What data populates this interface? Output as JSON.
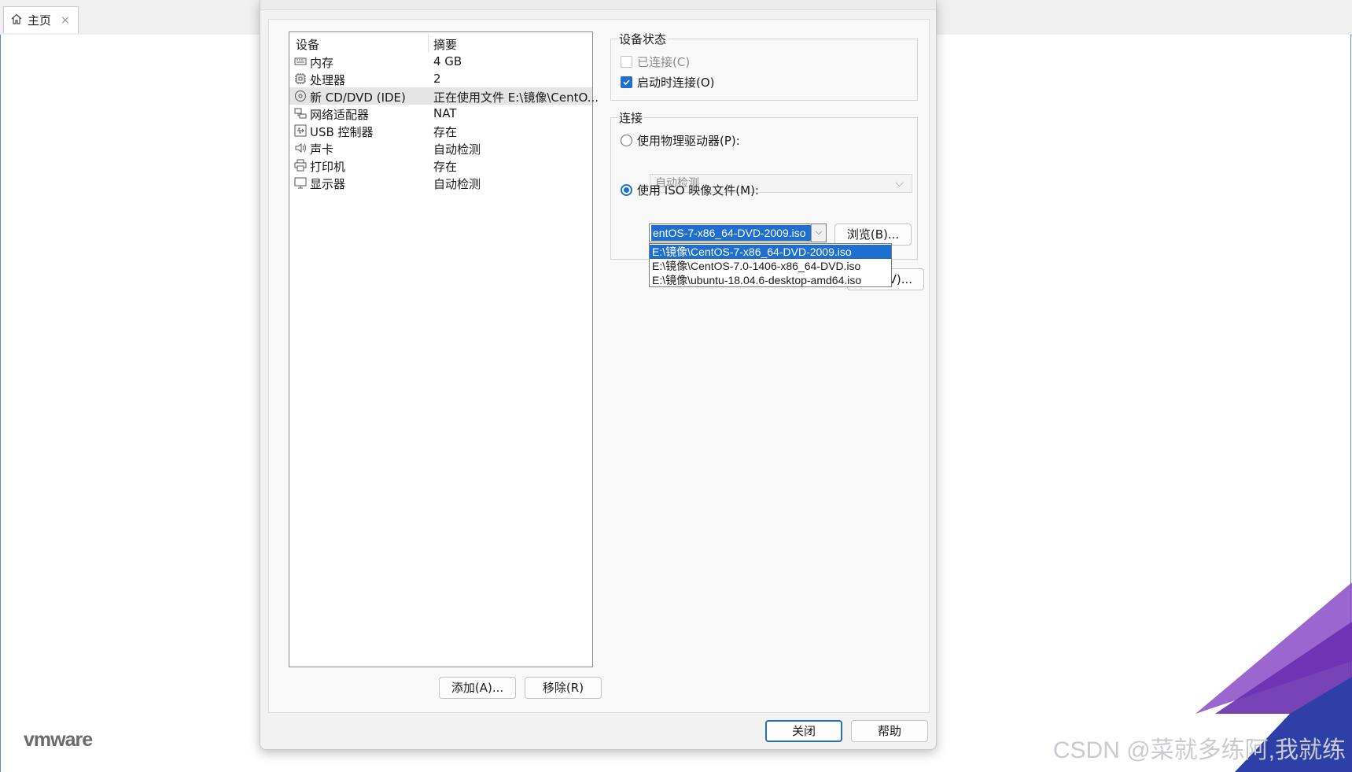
{
  "tab": {
    "label": "主页",
    "close": "×"
  },
  "branding": {
    "logo": "vmware",
    "watermark": "CSDN @菜就多练阿,我就练"
  },
  "device_list": {
    "header": {
      "device": "设备",
      "summary": "摘要"
    },
    "rows": [
      {
        "name": "内存",
        "summary": "4 GB",
        "icon": "memory-icon"
      },
      {
        "name": "处理器",
        "summary": "2",
        "icon": "cpu-icon"
      },
      {
        "name": "新 CD/DVD (IDE)",
        "summary": "正在使用文件 E:\\镜像\\CentO...",
        "icon": "cd-dvd-icon",
        "selected": true
      },
      {
        "name": "网络适配器",
        "summary": "NAT",
        "icon": "network-adapter-icon"
      },
      {
        "name": "USB 控制器",
        "summary": "存在",
        "icon": "usb-icon"
      },
      {
        "name": "声卡",
        "summary": "自动检测",
        "icon": "sound-card-icon"
      },
      {
        "name": "打印机",
        "summary": "存在",
        "icon": "printer-icon"
      },
      {
        "name": "显示器",
        "summary": "自动检测",
        "icon": "display-icon"
      }
    ]
  },
  "buttons": {
    "add": "添加(A)...",
    "remove": "移除(R)",
    "close": "关闭",
    "help": "帮助",
    "browse": "浏览(B)...",
    "advanced_partial": "V)..."
  },
  "device_status": {
    "title": "设备状态",
    "connected": {
      "label": "已连接(C)",
      "checked": false,
      "disabled": true
    },
    "connect_on_start": {
      "label": "启动时连接(O)",
      "checked": true
    }
  },
  "connection": {
    "title": "连接",
    "physical": {
      "label": "使用物理驱动器(P):",
      "selected": false
    },
    "physical_select": "自动检测",
    "iso": {
      "label": "使用 ISO 映像文件(M):",
      "selected": true
    },
    "iso_value": "entOS-7-x86_64-DVD-2009.iso",
    "iso_options": [
      "E:\\镜像\\CentOS-7-x86_64-DVD-2009.iso",
      "E:\\镜像\\CentOS-7.0-1406-x86_64-DVD.iso",
      "E:\\镜像\\ubuntu-18.04.6-desktop-amd64.iso"
    ]
  },
  "colors": {
    "accent": "#1e6fcf",
    "selection_row": "#e5e5e5"
  }
}
